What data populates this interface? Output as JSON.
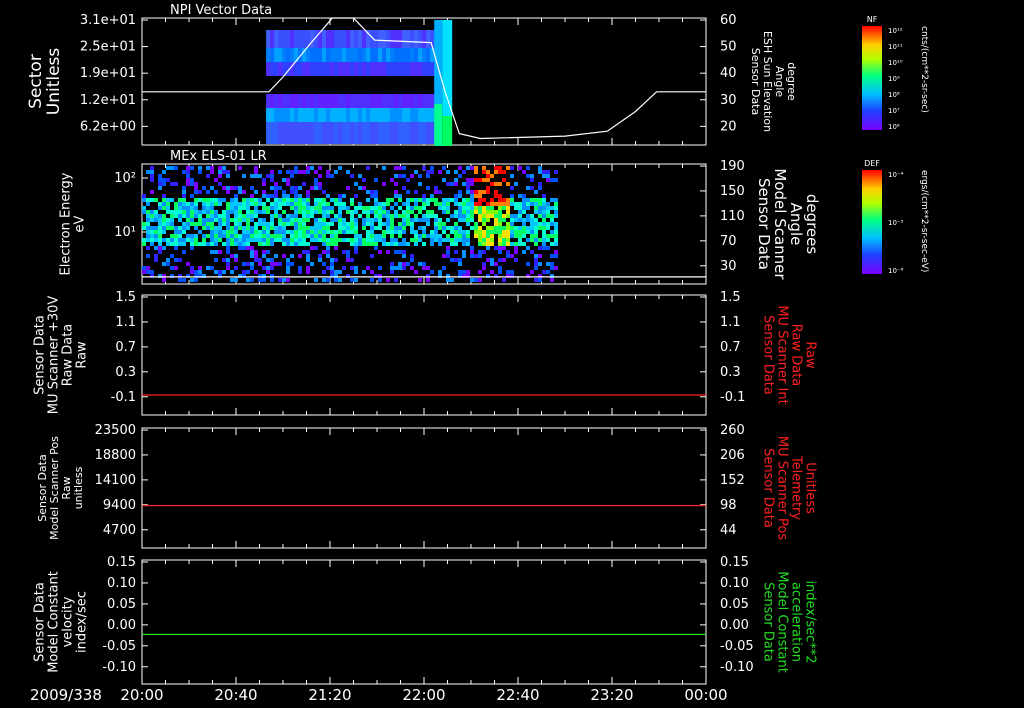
{
  "time_axis": {
    "date_label": "2009/338",
    "tick_labels": [
      "20:00",
      "20:40",
      "21:20",
      "22:00",
      "22:40",
      "23:20",
      "00:00"
    ],
    "range_hours": [
      20,
      24
    ]
  },
  "colorbars": [
    {
      "title": "NF",
      "units": "cnts/(cm**2-sr-sec)",
      "tick_labels": [
        "10¹²",
        "10¹¹",
        "10¹⁰",
        "10⁹",
        "10⁸",
        "10⁷",
        "10⁶"
      ]
    },
    {
      "title": "DEF",
      "units": "ergs/(cm**2-sr-sec-eV)",
      "tick_labels": [
        "10⁻⁴",
        "10⁻⁵",
        "10⁻⁶"
      ]
    }
  ],
  "chart_data": [
    {
      "type": "heatmap",
      "title": "NPI Vector Data",
      "left_axis": {
        "label_lines": [
          "Sector",
          "Unitless"
        ],
        "tick_labels": [
          "3.1e+01",
          "2.5e+01",
          "1.9e+01",
          "1.2e+01",
          "6.2e+00"
        ]
      },
      "right_axis": {
        "label_lines": [
          "Sensor Data",
          "ESH Sun Elevation",
          "Angle",
          "degree"
        ],
        "tick_labels": [
          "60",
          "50",
          "40",
          "30",
          "20"
        ],
        "ylim": [
          10,
          60
        ]
      },
      "overlay_line": {
        "name": "ESH Sun Elevation",
        "color": "#ffffff",
        "x": [
          20.0,
          20.9,
          21.0,
          21.2,
          21.35,
          21.5,
          21.65,
          22.05,
          22.15,
          22.25,
          22.4,
          23.0,
          23.3,
          23.5,
          23.65,
          24.0
        ],
        "y": [
          30,
          30,
          36,
          50,
          60,
          60,
          51,
          50,
          30,
          13,
          11,
          12,
          14,
          22,
          30,
          30
        ]
      },
      "data_extent_hours": [
        20.88,
        22.2
      ]
    },
    {
      "type": "heatmap",
      "title": "MEx ELS-01 LR",
      "left_axis": {
        "label_lines": [
          "Electron Energy",
          "eV"
        ],
        "tick_labels": [
          "10²",
          "10¹"
        ],
        "log": true
      },
      "right_axis": {
        "label_lines": [
          "Sensor Data",
          "Model Scanner",
          "Angle",
          "degrees"
        ],
        "tick_labels": [
          "190",
          "150",
          "110",
          "70",
          "30"
        ],
        "ylim": [
          5,
          190
        ]
      },
      "overlay_line": {
        "name": "Model Scanner Angle",
        "color": "#ffffff",
        "x": [
          20.0,
          24.0
        ],
        "y": [
          10,
          10
        ]
      },
      "data_extent_hours": [
        20.0,
        22.95
      ],
      "hot_spot_hours": [
        22.35,
        22.6
      ]
    },
    {
      "type": "line",
      "left_axis": {
        "label_lines": [
          "Sensor Data",
          "MU Scanner +30V",
          "Raw Data",
          "Raw"
        ],
        "tick_labels": [
          "1.5",
          "1.1",
          "0.7",
          "0.3",
          "-0.1"
        ]
      },
      "right_axis": {
        "label_lines": [
          "Sensor Data",
          "MU Scanner Int",
          "Raw Data",
          "Raw"
        ],
        "tick_labels": [
          "1.5",
          "1.1",
          "0.7",
          "0.3",
          "-0.1"
        ],
        "label_color": "#ff2020"
      },
      "ylim": [
        -0.3,
        1.5
      ],
      "series": [
        {
          "color": "#ff2020",
          "x": [
            20.0,
            24.0
          ],
          "y": [
            0.0,
            0.0
          ]
        }
      ]
    },
    {
      "type": "line",
      "left_axis": {
        "label_lines": [
          "Sensor Data",
          "Model Scanner Pos",
          "Raw",
          "unitless"
        ],
        "tick_labels": [
          "23500",
          "18800",
          "14100",
          "9400",
          "4700"
        ]
      },
      "right_axis": {
        "label_lines": [
          "Sensor Data",
          "MU Scanner Pos",
          "Telemetry",
          "Unitless"
        ],
        "tick_labels": [
          "260",
          "206",
          "152",
          "98",
          "44"
        ],
        "label_color": "#ff2020"
      },
      "ylim": [
        0,
        23500
      ],
      "series": [
        {
          "color": "#ff2020",
          "x": [
            20.0,
            24.0
          ],
          "y": [
            8300,
            8300
          ]
        }
      ]
    },
    {
      "type": "line",
      "left_axis": {
        "label_lines": [
          "Sensor Data",
          "Model Constant",
          "velocity",
          "index/sec"
        ],
        "tick_labels": [
          "0.15",
          "0.10",
          "0.05",
          "0.00",
          "-0.05",
          "-0.10"
        ]
      },
      "right_axis": {
        "label_lines": [
          "Sensor Data",
          "Model Constant",
          "acceleration",
          "index/sec**2"
        ],
        "tick_labels": [
          "0.15",
          "0.10",
          "0.05",
          "0.00",
          "-0.05",
          "-0.10"
        ],
        "label_color": "#22dd22"
      },
      "ylim": [
        -0.1,
        0.15
      ],
      "series": [
        {
          "color": "#22dd22",
          "x": [
            20.0,
            24.0
          ],
          "y": [
            0.0,
            0.0
          ]
        }
      ]
    }
  ]
}
